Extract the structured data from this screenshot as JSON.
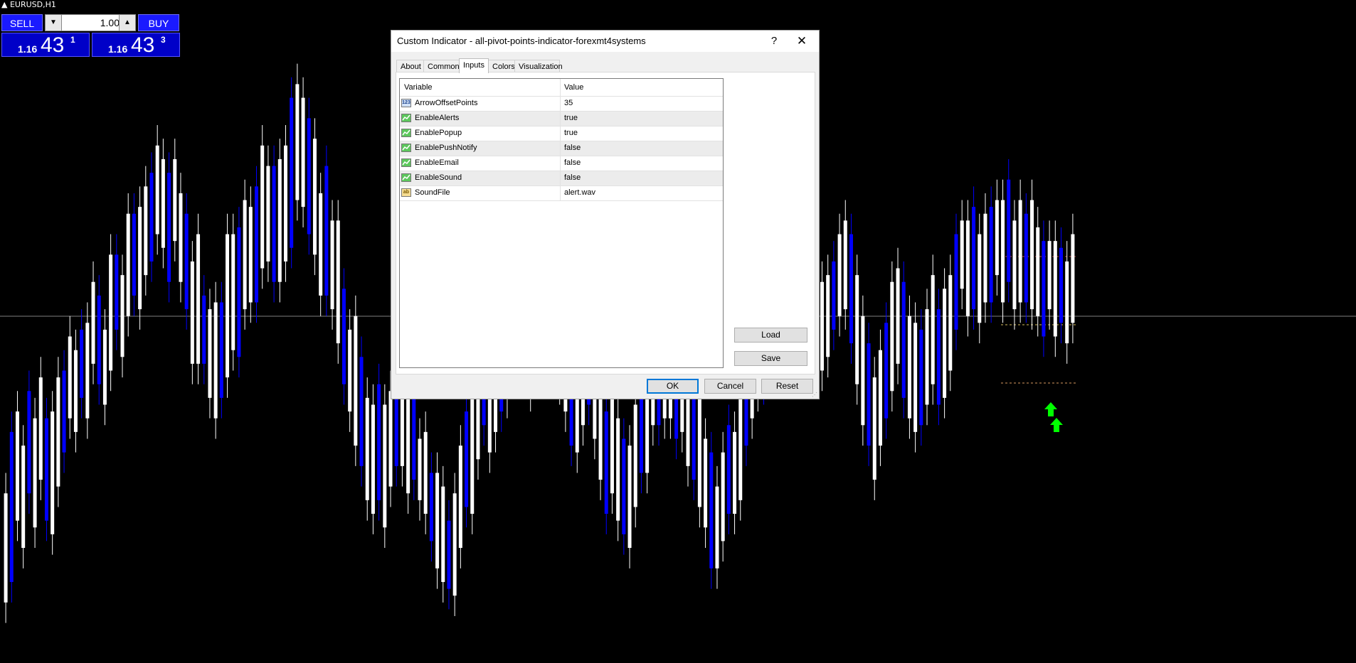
{
  "chart": {
    "symbol": "EURUSD,H1",
    "colors": {
      "up": "#ffffff",
      "down": "#0000ff",
      "grid": "#808080",
      "signal_arrow": "#00ff00",
      "pivot_lines": "#c0504d"
    },
    "candles": [
      [
        0.62,
        0.78
      ],
      [
        0.65,
        0.87
      ],
      [
        0.74,
        0.9
      ],
      [
        0.7,
        0.85
      ],
      [
        0.78,
        0.93
      ],
      [
        0.73,
        0.89
      ],
      [
        0.8,
        0.95
      ],
      [
        0.74,
        0.89
      ],
      [
        0.72,
        0.9
      ],
      [
        0.79,
        0.95
      ],
      [
        0.84,
        0.96
      ],
      [
        0.89,
        1.01
      ],
      [
        0.87,
        0.99
      ],
      [
        0.92,
        1.02
      ],
      [
        0.89,
        1.03
      ],
      [
        0.97,
        1.09
      ],
      [
        0.94,
        1.07
      ],
      [
        0.91,
        1.02
      ],
      [
        0.96,
        1.13
      ],
      [
        1.02,
        1.13
      ],
      [
        0.98,
        1.1
      ],
      [
        1.04,
        1.19
      ],
      [
        1.07,
        1.19
      ],
      [
        1.05,
        1.2
      ],
      [
        1.1,
        1.23
      ],
      [
        1.12,
        1.25
      ],
      [
        1.16,
        1.29
      ],
      [
        1.14,
        1.27
      ],
      [
        1.09,
        1.25
      ],
      [
        1.15,
        1.27
      ],
      [
        1.09,
        1.22
      ],
      [
        1.05,
        1.19
      ],
      [
        0.97,
        1.12
      ],
      [
        0.97,
        1.16
      ],
      [
        0.97,
        1.07
      ],
      [
        0.92,
        1.05
      ],
      [
        0.89,
        1.06
      ],
      [
        0.92,
        1.06
      ],
      [
        0.95,
        1.16
      ],
      [
        0.99,
        1.16
      ],
      [
        0.98,
        1.17
      ],
      [
        1.05,
        1.21
      ],
      [
        1.06,
        1.2
      ],
      [
        1.06,
        1.23
      ],
      [
        1.11,
        1.29
      ],
      [
        1.12,
        1.26
      ],
      [
        1.09,
        1.26
      ],
      [
        1.09,
        1.27
      ],
      [
        1.12,
        1.29
      ],
      [
        1.14,
        1.36
      ],
      [
        1.21,
        1.38
      ],
      [
        1.2,
        1.36
      ],
      [
        1.16,
        1.33
      ],
      [
        1.13,
        1.3
      ],
      [
        1.07,
        1.22
      ],
      [
        1.07,
        1.26
      ],
      [
        1.05,
        1.18
      ],
      [
        1.0,
        1.18
      ],
      [
        0.94,
        1.08
      ],
      [
        0.9,
        1.02
      ],
      [
        0.85,
        1.04
      ],
      [
        0.82,
        0.98
      ],
      [
        0.77,
        0.92
      ],
      [
        0.75,
        0.91
      ],
      [
        0.77,
        0.94
      ],
      [
        0.73,
        0.91
      ],
      [
        0.79,
        0.93
      ],
      [
        0.82,
        0.97
      ],
      [
        0.82,
        0.97
      ],
      [
        0.78,
        0.92
      ],
      [
        0.8,
        0.92
      ],
      [
        0.77,
        0.86
      ],
      [
        0.75,
        0.87
      ],
      [
        0.71,
        0.81
      ],
      [
        0.67,
        0.81
      ],
      [
        0.65,
        0.79
      ],
      [
        0.64,
        0.74
      ],
      [
        0.63,
        0.78
      ],
      [
        0.7,
        0.85
      ],
      [
        0.76,
        0.9
      ],
      [
        0.75,
        0.94
      ],
      [
        0.83,
        0.98
      ],
      [
        0.88,
        1.02
      ],
      [
        0.84,
        0.98
      ],
      [
        0.87,
        1.03
      ],
      [
        0.9,
        1.04
      ],
      [
        0.92,
        1.07
      ],
      [
        0.96,
        1.12
      ],
      [
        1.01,
        1.11
      ],
      [
        0.98,
        1.12
      ],
      [
        0.93,
        1.09
      ],
      [
        0.96,
        1.13
      ],
      [
        1.0,
        1.11
      ],
      [
        0.96,
        1.09
      ],
      [
        0.99,
        1.12
      ],
      [
        0.94,
        1.06
      ],
      [
        0.9,
        1.06
      ],
      [
        0.85,
        1.03
      ],
      [
        0.84,
        1.01
      ],
      [
        0.88,
        1.05
      ],
      [
        0.91,
        1.04
      ],
      [
        0.86,
        1.0
      ],
      [
        0.8,
        0.97
      ],
      [
        0.75,
        0.9
      ],
      [
        0.78,
        0.92
      ],
      [
        0.74,
        0.89
      ],
      [
        0.72,
        0.86
      ],
      [
        0.7,
        0.85
      ],
      [
        0.76,
        0.91
      ],
      [
        0.81,
        0.96
      ],
      [
        0.81,
        0.97
      ],
      [
        0.88,
        1.0
      ],
      [
        0.88,
        1.03
      ],
      [
        0.89,
        1.01
      ],
      [
        0.89,
        1.05
      ],
      [
        0.86,
        0.99
      ],
      [
        0.87,
        0.97
      ],
      [
        0.82,
        0.97
      ],
      [
        0.8,
        0.93
      ],
      [
        0.76,
        0.92
      ],
      [
        0.73,
        0.86
      ],
      [
        0.67,
        0.84
      ],
      [
        0.67,
        0.79
      ],
      [
        0.71,
        0.84
      ],
      [
        0.75,
        0.88
      ],
      [
        0.75,
        0.87
      ],
      [
        0.77,
        0.93
      ],
      [
        0.85,
        1.01
      ],
      [
        0.89,
        1.02
      ],
      [
        0.93,
        1.07
      ],
      [
        0.94,
        1.09
      ],
      [
        0.99,
        1.13
      ],
      [
        0.99,
        1.13
      ],
      [
        1.01,
        1.15
      ],
      [
        1.02,
        1.17
      ],
      [
        1.04,
        1.17
      ],
      [
        1.02,
        1.14
      ],
      [
        1.03,
        1.16
      ],
      [
        0.99,
        1.15
      ],
      [
        0.97,
        1.08
      ],
      [
        0.96,
        1.09
      ],
      [
        0.98,
        1.1
      ],
      [
        1.02,
        1.12
      ],
      [
        1.04,
        1.16
      ],
      [
        1.05,
        1.18
      ],
      [
        1.0,
        1.16
      ],
      [
        0.94,
        1.1
      ],
      [
        0.88,
        1.04
      ],
      [
        0.85,
        1.0
      ],
      [
        0.8,
        0.95
      ],
      [
        0.85,
        0.99
      ],
      [
        0.89,
        1.03
      ],
      [
        0.93,
        1.09
      ],
      [
        0.97,
        1.11
      ],
      [
        0.92,
        1.09
      ],
      [
        0.89,
        1.04
      ],
      [
        0.87,
        1.03
      ],
      [
        0.88,
        1.02
      ],
      [
        0.91,
        1.05
      ],
      [
        0.94,
        1.1
      ],
      [
        0.91,
        1.05
      ],
      [
        0.92,
        1.08
      ],
      [
        0.96,
        1.1
      ],
      [
        1.02,
        1.16
      ],
      [
        1.08,
        1.18
      ],
      [
        1.04,
        1.18
      ],
      [
        1.05,
        1.2
      ],
      [
        1.03,
        1.16
      ],
      [
        1.06,
        1.19
      ],
      [
        1.06,
        1.2
      ],
      [
        1.1,
        1.21
      ],
      [
        1.06,
        1.21
      ],
      [
        1.09,
        1.24
      ],
      [
        1.05,
        1.18
      ],
      [
        1.06,
        1.21
      ],
      [
        1.06,
        1.19
      ],
      [
        1.05,
        1.21
      ],
      [
        1.04,
        1.17
      ],
      [
        1.01,
        1.15
      ],
      [
        1.05,
        1.15
      ],
      [
        1.01,
        1.15
      ],
      [
        1.03,
        1.14
      ],
      [
        1.0,
        1.12
      ],
      [
        1.03,
        1.16
      ]
    ],
    "signal_arrows": 2
  },
  "trade_panel": {
    "sell_label": "SELL",
    "buy_label": "BUY",
    "lot_value": "1.00",
    "lot_down_icon": "triangle-down-icon",
    "lot_up_icon": "triangle-up-icon",
    "sell_price": {
      "prefix": "1.16",
      "big": "43",
      "sup": "1"
    },
    "buy_price": {
      "prefix": "1.16",
      "big": "43",
      "sup": "3"
    }
  },
  "dialog": {
    "title": "Custom Indicator - all-pivot-points-indicator-forexmt4systems",
    "help_icon": "?",
    "close_icon": "✕",
    "tabs": [
      "About",
      "Common",
      "Inputs",
      "Colors",
      "Visualization"
    ],
    "active_tab": "Inputs",
    "table": {
      "headers": [
        "Variable",
        "Value"
      ],
      "rows": [
        {
          "icon": "123",
          "type": "number",
          "name": "ArrowOffsetPoints",
          "value": "35"
        },
        {
          "icon": "",
          "type": "bool",
          "name": "EnableAlerts",
          "value": "true"
        },
        {
          "icon": "",
          "type": "bool",
          "name": "EnablePopup",
          "value": "true"
        },
        {
          "icon": "",
          "type": "bool",
          "name": "EnablePushNotify",
          "value": "false"
        },
        {
          "icon": "",
          "type": "bool",
          "name": "EnableEmail",
          "value": "false"
        },
        {
          "icon": "",
          "type": "bool",
          "name": "EnableSound",
          "value": "false"
        },
        {
          "icon": "ab",
          "type": "string",
          "name": "SoundFile",
          "value": "alert.wav"
        }
      ]
    },
    "load_label": "Load",
    "save_label": "Save",
    "ok_label": "OK",
    "cancel_label": "Cancel",
    "reset_label": "Reset"
  }
}
